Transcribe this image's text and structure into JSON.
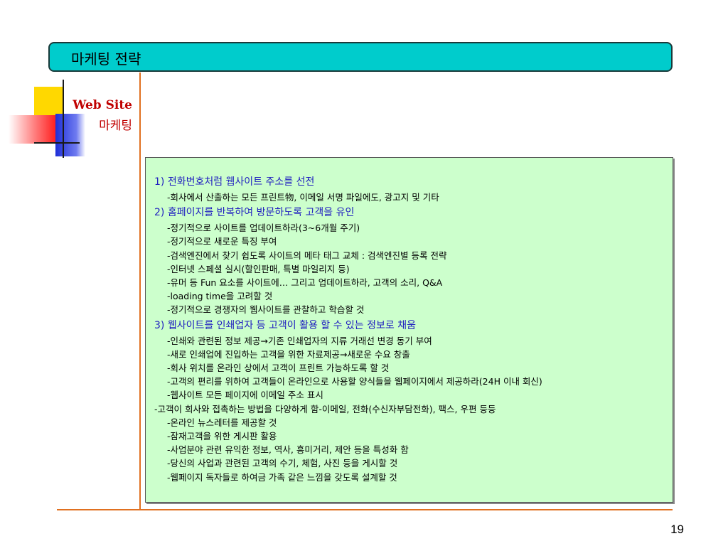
{
  "slide": {
    "title": "마케팅 전략",
    "side_label_line1": "Web Site",
    "side_label_line2": "마케팅",
    "page_number": "19"
  },
  "content": {
    "lines": [
      {
        "kind": "head",
        "text": "1) 전화번호처럼 웹사이트 주소를 선전"
      },
      {
        "kind": "sub",
        "text": "-회사에서 산출하는 모든 프린트物, 이메일 서명 파일에도, 광고지 및 기타"
      },
      {
        "kind": "head",
        "text": "2) 홈페이지를 반복하여 방문하도록 고객을 유인"
      },
      {
        "kind": "sub",
        "text": "-정기적으로 사이트를 업데이트하라(3~6개월 주기)"
      },
      {
        "kind": "sub",
        "text": "-정기적으로 새로운 특징 부여"
      },
      {
        "kind": "sub",
        "text": "-검색엔진에서 찾기 쉽도록 사이트의 메타 태그 교체 : 검색엔진별 등록 전략"
      },
      {
        "kind": "sub",
        "text": "-인터넷 스페셜 실시(할인판매, 특별 마일리지 등)"
      },
      {
        "kind": "sub",
        "text": "-유머 등 Fun 요소를 사이트에… 그리고 업데이트하라, 고객의 소리, Q&A"
      },
      {
        "kind": "sub",
        "text": "-loading time을 고려할 것"
      },
      {
        "kind": "sub",
        "text": "-정기적으로 경쟁자의 웹사이트를 관찰하고 학습할 것"
      },
      {
        "kind": "head",
        "text": "3) 웹사이트를 인쇄업자 등 고객이 활용 할 수 있는 정보로 채움"
      },
      {
        "kind": "sub",
        "text": "-인쇄와 관련된 정보 제공→기존 인쇄업자의 지류 거래선 변경 동기 부여"
      },
      {
        "kind": "sub",
        "text": "-새로 인쇄업에 진입하는 고객을 위한 자료제공→새로운 수요 창출"
      },
      {
        "kind": "sub",
        "text": "-회사 위치를 온라인 상에서 고객이 프린트 가능하도록 할 것"
      },
      {
        "kind": "sub",
        "text": "-고객의 편리를 위하여 고객들이 온라인으로 사용할 양식들을 웹페이지에서 제공하라(24H 이내 회신)"
      },
      {
        "kind": "sub",
        "text": "-웹사이트 모든 페이지에 이메일 주소 표시"
      },
      {
        "kind": "flush",
        "text": "-고객이 회사와 접촉하는 방법을 다양하게 함-이메일, 전화(수신자부담전화), 팩스, 우편 등등"
      },
      {
        "kind": "sub",
        "text": "-온라인 뉴스레터를 제공할 것"
      },
      {
        "kind": "sub",
        "text": "-잠재고객을 위한 게시판 활용"
      },
      {
        "kind": "sub",
        "text": "-사업분야 관련 유익한 정보, 역사, 흥미거리, 제안 등을 특성화 함"
      },
      {
        "kind": "sub",
        "text": "-당신의 사업과 관련된 고객의 수기, 체험, 사진 등을 게시할 것"
      },
      {
        "kind": "sub",
        "text": "-웹페이지 독자들로 하여금 가족 같은 느낌을 갖도록 설계할 것"
      }
    ]
  }
}
